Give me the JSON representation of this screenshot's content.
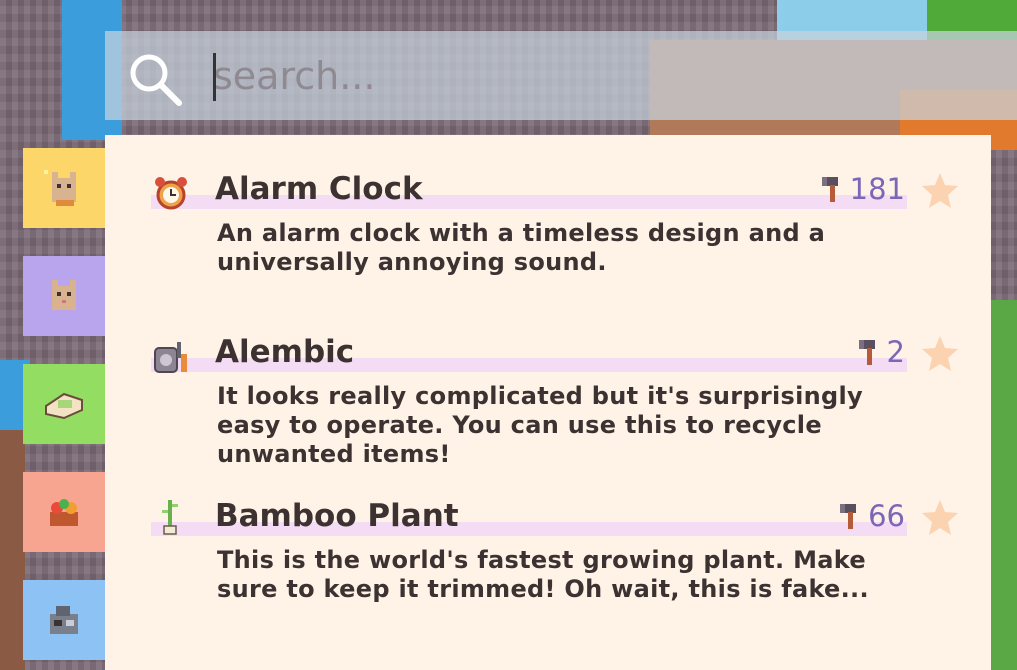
{
  "search": {
    "placeholder": "search..."
  },
  "category_tabs": [
    {
      "icon": "cat-sparkle-icon",
      "color": "#fdd66a"
    },
    {
      "icon": "cat-icon",
      "color": "#b9a4ee"
    },
    {
      "icon": "bread-icon",
      "color": "#93dd63"
    },
    {
      "icon": "fruit-basket-icon",
      "color": "#f7a590"
    },
    {
      "icon": "machine-icon",
      "color": "#8dc2f5"
    }
  ],
  "items": [
    {
      "title": "Alarm Clock",
      "description": "An alarm clock with a timeless design and a universally annoying sound.",
      "count": "181",
      "icon": "alarm-clock-icon"
    },
    {
      "title": "Alembic",
      "description": "It looks really complicated but it's surprisingly easy to operate. You can use this to recycle unwanted items!",
      "count": "2",
      "icon": "alembic-icon"
    },
    {
      "title": "Bamboo Plant",
      "description": "This is the world's fastest growing plant. Make sure to keep it trimmed! Oh wait, this is fake...",
      "count": "66",
      "icon": "bamboo-plant-icon"
    }
  ],
  "colors": {
    "panel_bg": "#fff2e6",
    "title_band": "#f5dcf5",
    "count_text": "#7b66b8",
    "star": "#fbd3b1",
    "text": "#3c3232"
  }
}
